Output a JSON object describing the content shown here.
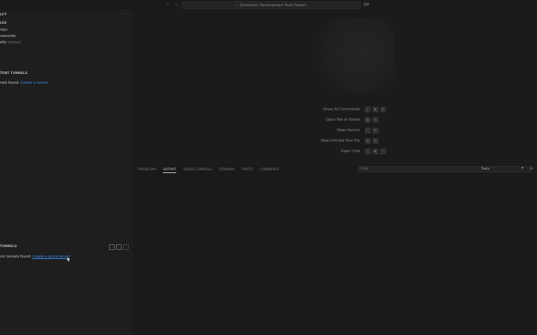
{
  "titlebar": {
    "back_glyph": "←",
    "forward_glyph": "→",
    "search_text": "[Extension Development Host] Search",
    "copilot_glyph": "⛭▾"
  },
  "sidebar": {
    "top_header": "LFY",
    "more_glyph": "···",
    "profiles_header": "LES",
    "items": [
      {
        "label": "reys",
        "suffix": ""
      },
      {
        "label": "vescords",
        "suffix": ""
      },
      {
        "label": "elfy",
        "suffix": "(active)"
      }
    ],
    "tunnels_header": "TENT TUNNELS",
    "tunnels_empty_text": "nels found.",
    "tunnels_link": "Create a tunnel",
    "quick_header": "TUNNELS",
    "quick_empty_text": "ick tunnels found.",
    "quick_link": "Create a quick tunnel"
  },
  "editor": {
    "shortcuts": [
      {
        "label": "Show All Commands",
        "keys": [
          "⇧",
          "⌘",
          "P"
        ]
      },
      {
        "label": "Open File or Folder",
        "keys": [
          "⌘",
          "O"
        ]
      },
      {
        "label": "Open Recent",
        "keys": [
          "^",
          "R"
        ]
      },
      {
        "label": "New Untitled Text File",
        "keys": [
          "⌘",
          "N"
        ]
      },
      {
        "label": "Open Chat",
        "keys": [
          "^",
          "⌘",
          "I"
        ]
      }
    ]
  },
  "panel": {
    "tabs": [
      "PROBLEMS",
      "OUTPUT",
      "DEBUG CONSOLE",
      "TERMINAL",
      "PORTS",
      "COMMENTS"
    ],
    "active_tab": "OUTPUT",
    "filter_placeholder": "Filter",
    "tasks_value": "Tasks",
    "chevron_glyph": "▾",
    "menu_glyph": "☰"
  },
  "colors": {
    "background": "#1b1b1c",
    "sidebar": "#1e1e1f",
    "link": "#3f8ee6"
  }
}
